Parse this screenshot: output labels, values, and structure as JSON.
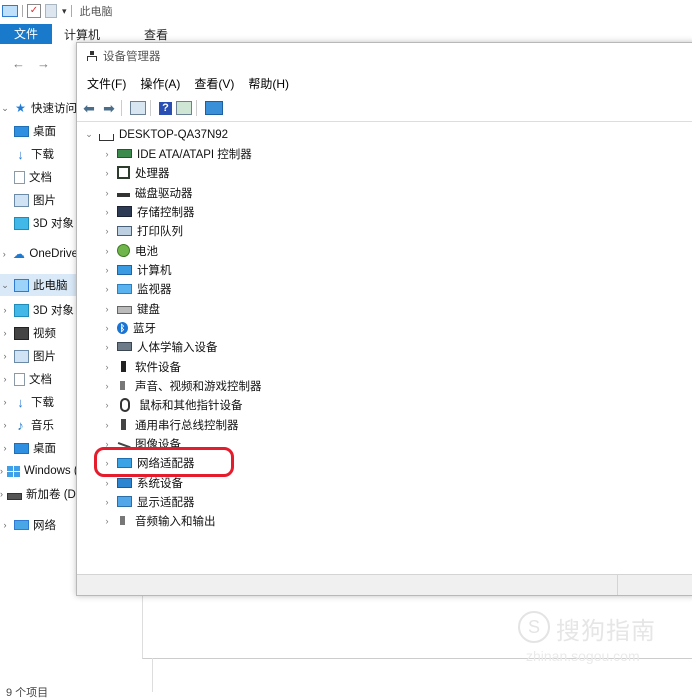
{
  "explorer": {
    "title": "此电脑",
    "tabs": [
      "文件",
      "计算机",
      "查看"
    ],
    "nav_back": "←",
    "nav_forward": "→",
    "tree": [
      {
        "label": "快速访问",
        "icon": "star-icon"
      },
      {
        "label": "桌面",
        "icon": "desktop-icon"
      },
      {
        "label": "下载",
        "icon": "download-icon"
      },
      {
        "label": "文档",
        "icon": "document-icon"
      },
      {
        "label": "图片",
        "icon": "pictures-icon"
      },
      {
        "label": "3D 对象",
        "icon": "3d-objects-icon"
      },
      {
        "label": "OneDrive",
        "icon": "onedrive-icon"
      },
      {
        "label": "此电脑",
        "icon": "this-pc-icon"
      },
      {
        "label": "3D 对象",
        "icon": "3d-objects-icon"
      },
      {
        "label": "视频",
        "icon": "videos-icon"
      },
      {
        "label": "图片",
        "icon": "pictures-icon"
      },
      {
        "label": "文档",
        "icon": "document-icon"
      },
      {
        "label": "下载",
        "icon": "download-icon"
      },
      {
        "label": "音乐",
        "icon": "music-icon"
      },
      {
        "label": "桌面",
        "icon": "desktop-icon"
      },
      {
        "label": "Windows (C:)",
        "icon": "windows-drive-icon"
      },
      {
        "label": "新加卷 (D:)",
        "icon": "drive-icon"
      },
      {
        "label": "网络",
        "icon": "network-icon"
      }
    ],
    "status": "9 个项目"
  },
  "device_manager": {
    "title": "设备管理器",
    "menu": [
      "文件(F)",
      "操作(A)",
      "查看(V)",
      "帮助(H)"
    ],
    "root": "DESKTOP-QA37N92",
    "devices": [
      {
        "label": "IDE ATA/ATAPI 控制器",
        "icon": "ide-controller-icon"
      },
      {
        "label": "处理器",
        "icon": "processor-icon"
      },
      {
        "label": "磁盘驱动器",
        "icon": "disk-drive-icon"
      },
      {
        "label": "存储控制器",
        "icon": "storage-controller-icon"
      },
      {
        "label": "打印队列",
        "icon": "print-queue-icon"
      },
      {
        "label": "电池",
        "icon": "battery-icon"
      },
      {
        "label": "计算机",
        "icon": "computer-icon"
      },
      {
        "label": "监视器",
        "icon": "monitor-icon"
      },
      {
        "label": "键盘",
        "icon": "keyboard-icon"
      },
      {
        "label": "蓝牙",
        "icon": "bluetooth-icon"
      },
      {
        "label": "人体学输入设备",
        "icon": "hid-icon"
      },
      {
        "label": "软件设备",
        "icon": "software-device-icon"
      },
      {
        "label": "声音、视频和游戏控制器",
        "icon": "sound-icon"
      },
      {
        "label": "鼠标和其他指针设备",
        "icon": "mouse-icon"
      },
      {
        "label": "通用串行总线控制器",
        "icon": "usb-icon"
      },
      {
        "label": "图像设备",
        "icon": "imaging-device-icon"
      },
      {
        "label": "网络适配器",
        "icon": "network-adapter-icon"
      },
      {
        "label": "系统设备",
        "icon": "system-device-icon"
      },
      {
        "label": "显示适配器",
        "icon": "display-adapter-icon"
      },
      {
        "label": "音频输入和输出",
        "icon": "audio-io-icon"
      }
    ],
    "highlight_color": "#e41c2c"
  },
  "watermark": {
    "text": "搜狗指南",
    "url": "zhinan.sogou.com"
  }
}
